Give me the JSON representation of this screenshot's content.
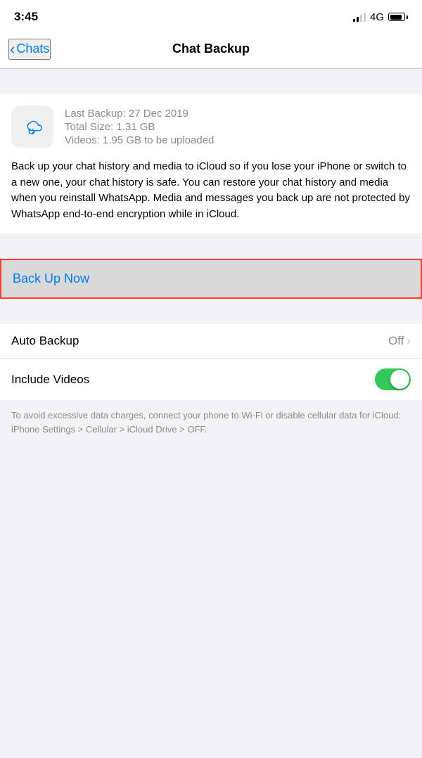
{
  "statusBar": {
    "time": "3:45",
    "network": "4G"
  },
  "nav": {
    "backLabel": "Chats",
    "title": "Chat Backup"
  },
  "backupInfo": {
    "lastBackup": "Last Backup: 27 Dec 2019",
    "totalSize": "Total Size: 1.31 GB",
    "videos": "Videos: 1.95 GB to be uploaded"
  },
  "description": "Back up your chat history and media to iCloud so if you lose your iPhone or switch to a new one, your chat history is safe. You can restore your chat history and media when you reinstall WhatsApp. Media and messages you back up are not protected by WhatsApp end-to-end encryption while in iCloud.",
  "backUpNowLabel": "Back Up Now",
  "settings": [
    {
      "label": "Auto Backup",
      "value": "Off",
      "type": "chevron"
    },
    {
      "label": "Include Videos",
      "value": "",
      "type": "toggle",
      "toggleOn": true
    }
  ],
  "footerNote": "To avoid excessive data charges, connect your phone to Wi-Fi or disable cellular data for iCloud: iPhone Settings > Cellular > iCloud Drive > OFF."
}
